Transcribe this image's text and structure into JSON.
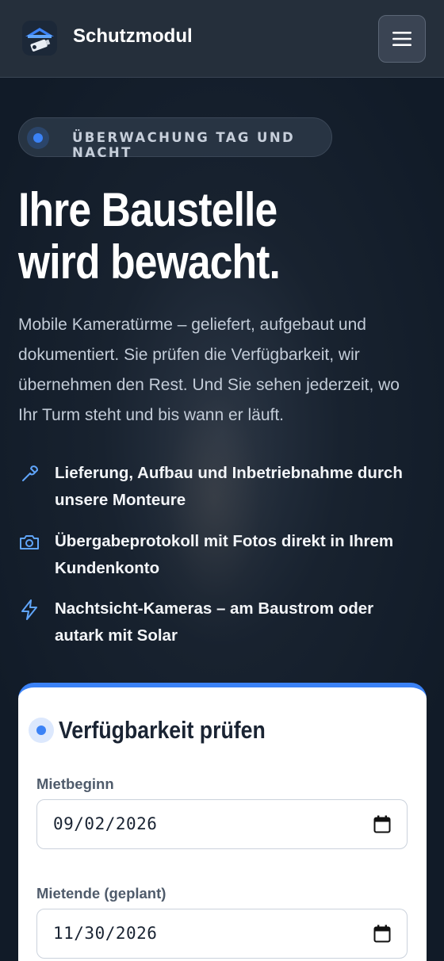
{
  "header": {
    "brand": "Schutzmodul",
    "logo_icon": "camera-tower-logo",
    "menu_icon": "hamburger-menu-icon"
  },
  "hero": {
    "eyebrow": "ÜBERWACHUNG TAG UND NACHT",
    "headline_line1": "Ihre Baustelle",
    "headline_line2": "wird bewacht.",
    "lead": "Mobile Kameratürme – geliefert, aufgebaut und dokumentiert. Sie prüfen die Verfügbarkeit, wir übernehmen den Rest. Und Sie sehen jederzeit, wo Ihr Turm steht und bis wann er läuft."
  },
  "features": [
    {
      "icon": "wrench-icon",
      "text": "Lieferung, Aufbau und Inbetriebnahme durch unsere Monteure"
    },
    {
      "icon": "camera-icon",
      "text": "Übergabeprotokoll mit Fotos direkt in Ihrem Kundenkonto"
    },
    {
      "icon": "lightning-icon",
      "text": "Nachtsicht-Kameras – am Baustrom oder autark mit Solar"
    }
  ],
  "availability": {
    "title": "Verfügbarkeit prüfen",
    "start_label": "Mietbeginn",
    "start_value": "09/02/2026",
    "end_label": "Mietende (geplant)",
    "end_value": "11/30/2026"
  },
  "colors": {
    "accent": "#3b82f6",
    "background": "#111b28",
    "header": "#252f3b"
  }
}
